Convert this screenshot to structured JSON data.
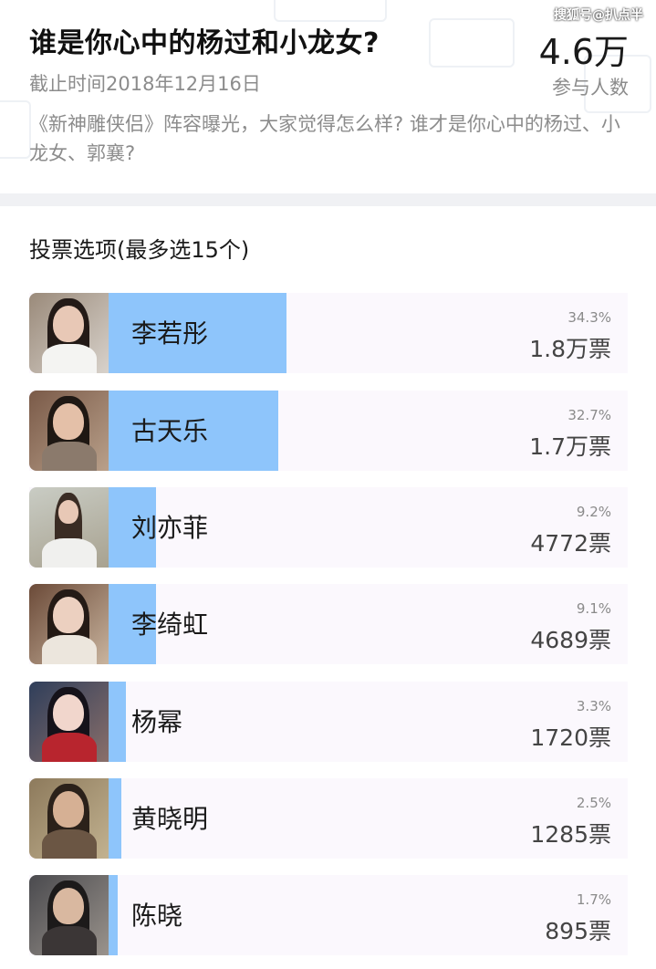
{
  "poll": {
    "title": "谁是你心中的杨过和小龙女?",
    "deadline": "截止时间2018年12月16日",
    "participants_count": "4.6万",
    "participants_label": "参与人数",
    "description": "《新神雕侠侣》阵容曝光，大家觉得怎么样? 谁才是你心中的杨过、小龙女、郭襄?",
    "watermark": "搜狐号@扒点半"
  },
  "section": {
    "title": "投票选项(最多选15个)"
  },
  "colors": {
    "bar_fill": "#8ec5fb",
    "option_bg": "#fbf8fd",
    "divider": "#f0f1f4"
  },
  "options": [
    {
      "name": "李若彤",
      "percent": "34.3%",
      "votes": "1.8万票",
      "share": 0.343,
      "avatar": "photo-li-ruotong"
    },
    {
      "name": "古天乐",
      "percent": "32.7%",
      "votes": "1.7万票",
      "share": 0.327,
      "avatar": "photo-gu-tianle"
    },
    {
      "name": "刘亦菲",
      "percent": "9.2%",
      "votes": "4772票",
      "share": 0.092,
      "avatar": "photo-liu-yifei"
    },
    {
      "name": "李绮虹",
      "percent": "9.1%",
      "votes": "4689票",
      "share": 0.091,
      "avatar": "photo-li-qihong"
    },
    {
      "name": "杨幂",
      "percent": "3.3%",
      "votes": "1720票",
      "share": 0.033,
      "avatar": "photo-yang-mi"
    },
    {
      "name": "黄晓明",
      "percent": "2.5%",
      "votes": "1285票",
      "share": 0.025,
      "avatar": "photo-huang-xiaoming"
    },
    {
      "name": "陈晓",
      "percent": "1.7%",
      "votes": "895票",
      "share": 0.017,
      "avatar": "photo-chen-xiao"
    }
  ]
}
